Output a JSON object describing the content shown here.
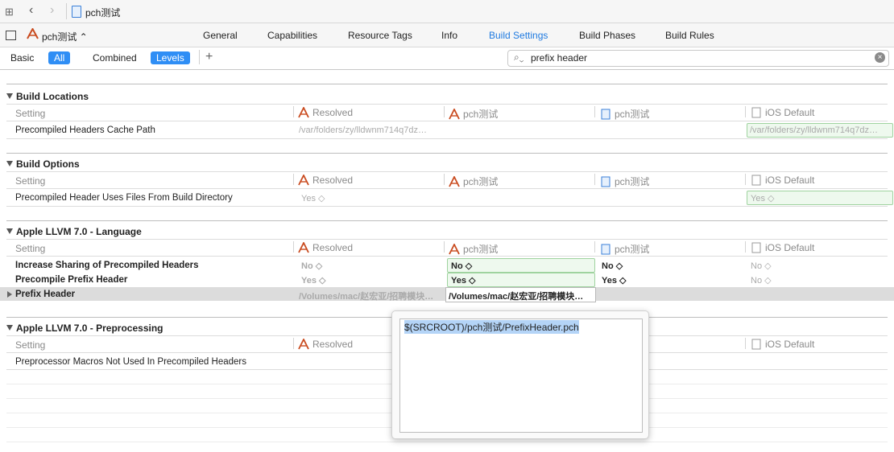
{
  "toolbar": {
    "file_name": "pch测试"
  },
  "target": {
    "name": "pch测试 ⌃"
  },
  "tabs": [
    "General",
    "Capabilities",
    "Resource Tags",
    "Info",
    "Build Settings",
    "Build Phases",
    "Build Rules"
  ],
  "active_tab": "Build Settings",
  "filters": {
    "basic": "Basic",
    "all": "All",
    "combined": "Combined",
    "levels": "Levels",
    "add": "+"
  },
  "search": {
    "value": "prefix header"
  },
  "columns": {
    "setting": "Setting",
    "resolved": "Resolved",
    "target": "pch测试",
    "project": "pch测试",
    "ios_default": "iOS Default"
  },
  "sections": [
    {
      "title": "Build Locations",
      "rows": [
        {
          "label": "Precompiled Headers Cache Path",
          "resolved": "/var/folders/zy/lldwnm714q7dz…",
          "target": "",
          "project": "",
          "default": "/var/folders/zy/lldwnm714q7dz…"
        }
      ]
    },
    {
      "title": "Build Options",
      "rows": [
        {
          "label": "Precompiled Header Uses Files From Build Directory",
          "resolved": "Yes ◇",
          "target": "",
          "project": "",
          "default": "Yes ◇"
        }
      ]
    },
    {
      "title": "Apple LLVM 7.0 - Language",
      "rows": [
        {
          "label": "Increase Sharing of Precompiled Headers",
          "resolved": "No ◇",
          "target": "No ◇",
          "project": "No ◇",
          "default": "No ◇"
        },
        {
          "label": "Precompile Prefix Header",
          "resolved": "Yes ◇",
          "target": "Yes ◇",
          "project": "Yes ◇",
          "default": "No ◇"
        },
        {
          "label": "Prefix Header",
          "resolved": "/Volumes/mac/赵宏亚/招聘模块…",
          "target": "/Volumes/mac/赵宏亚/招聘模块…",
          "project": "",
          "default": ""
        }
      ]
    },
    {
      "title": "Apple LLVM 7.0 - Preprocessing",
      "rows": [
        {
          "label": "Preprocessor Macros Not Used In Precompiled Headers",
          "resolved": "",
          "target": "",
          "project": "",
          "default": ""
        }
      ]
    }
  ],
  "popup": {
    "value": "$(SRCROOT)/pch测试/PrefixHeader.pch"
  },
  "colors": {
    "accent": "#2f8ef5",
    "active_tab": "#1f7ae0",
    "green_border": "#9fd39f",
    "selection": "#b4d4f7"
  }
}
